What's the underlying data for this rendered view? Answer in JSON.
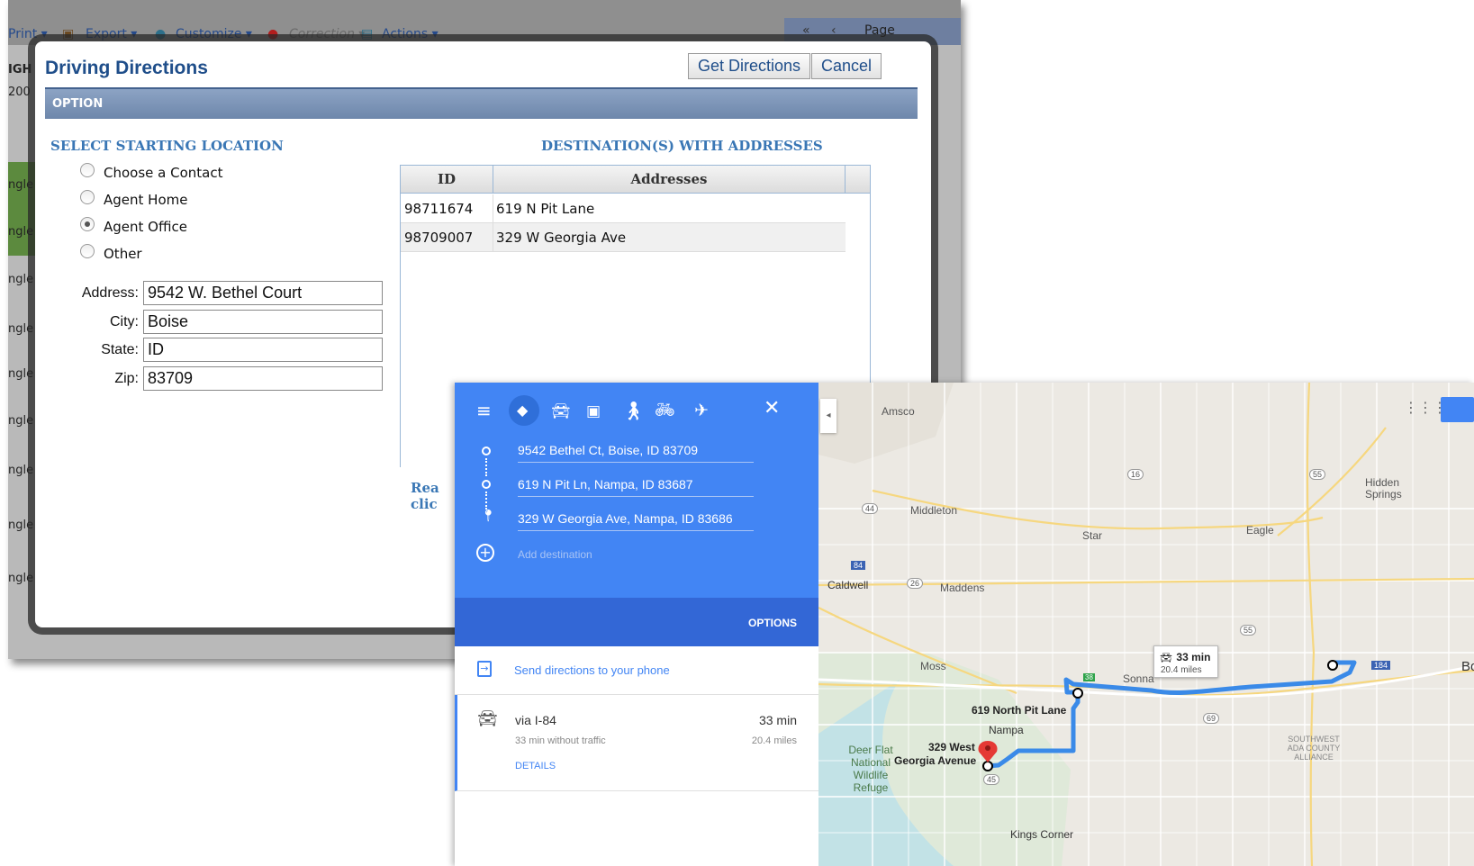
{
  "background_app": {
    "toolbar_items": [
      "Print",
      "Export",
      "Customize",
      "Correction",
      "Actions"
    ],
    "page_label": "Page",
    "side_labels": [
      "IGH",
      "200"
    ],
    "row_labels": [
      "ngle",
      "ngle",
      "ngle",
      "ngle",
      "ngle",
      "ngle",
      "ngle",
      "ngle",
      "ngle"
    ]
  },
  "dialog": {
    "title": "Driving Directions",
    "get_directions_label": "Get Directions",
    "cancel_label": "Cancel",
    "option_bar": "OPTION",
    "starting_heading": "SELECT STARTING LOCATION",
    "radios": [
      {
        "label": "Choose a Contact",
        "checked": false
      },
      {
        "label": "Agent Home",
        "checked": false
      },
      {
        "label": "Agent Office",
        "checked": true
      },
      {
        "label": "Other",
        "checked": false
      }
    ],
    "fields": {
      "address_label": "Address:",
      "address": "9542 W. Bethel Court",
      "city_label": "City:",
      "city": "Boise",
      "state_label": "State:",
      "state": "ID",
      "zip_label": "Zip:",
      "zip": "83709"
    },
    "dest_heading": "DESTINATION(S) WITH ADDRESSES",
    "grid": {
      "columns": [
        "ID",
        "Addresses"
      ],
      "rows": [
        {
          "id": "98711674",
          "address": "619 N Pit Lane"
        },
        {
          "id": "98709007",
          "address": "329 W Georgia Ave"
        }
      ]
    },
    "partial_text": [
      "Rea",
      "clic"
    ]
  },
  "google_maps": {
    "stops": [
      "9542 Bethel Ct, Boise, ID 83709",
      "619 N Pit Ln, Nampa, ID 83687",
      "329 W Georgia Ave, Nampa, ID 83686"
    ],
    "add_destination": "Add destination",
    "options_label": "OPTIONS",
    "send_label": "Send directions to your phone",
    "route": {
      "via": "via I-84",
      "time": "33 min",
      "traffic": "33 min without traffic",
      "distance": "20.4 miles",
      "details": "DETAILS"
    },
    "callout": {
      "time": "33 min",
      "distance": "20.4 miles"
    },
    "places": [
      "Amsco",
      "Middleton",
      "Star",
      "Eagle",
      "Hidden Springs",
      "Caldwell",
      "Maddens",
      "Moss",
      "Sonna",
      "Nampa",
      "Deer Flat National Wildlife Refuge",
      "SOUTHWEST ADA COUNTY ALLIANCE",
      "Kings Corner",
      "Bo"
    ],
    "markers": {
      "pit": "619 North Pit Lane",
      "georgia1": "329 West",
      "georgia2": "Georgia Avenue"
    },
    "shields": [
      "16",
      "55",
      "44",
      "26",
      "84",
      "184",
      "55",
      "69",
      "45",
      "38"
    ]
  }
}
